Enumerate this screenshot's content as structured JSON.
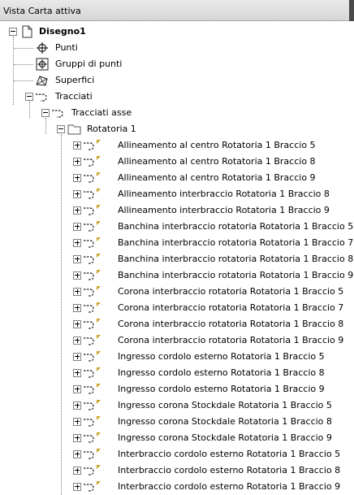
{
  "window": {
    "title": "Vista Carta attiva"
  },
  "tree": {
    "root": {
      "label": "Disegno1"
    },
    "level1": [
      {
        "label": "Punti",
        "icon": "point-icon"
      },
      {
        "label": "Gruppi di punti",
        "icon": "point-group-icon"
      },
      {
        "label": "Superfici",
        "icon": "surface-icon"
      },
      {
        "label": "Tracciati",
        "icon": "alignment-icon"
      }
    ],
    "alignment_group": {
      "label": "Tracciati asse",
      "icon": "alignment-icon"
    },
    "folder": {
      "label": "Rotatoria 1",
      "icon": "folder-icon"
    },
    "alignments": [
      {
        "label": "Allineamento al centro Rotatoria 1 Braccio 5"
      },
      {
        "label": "Allineamento al centro Rotatoria 1 Braccio 8"
      },
      {
        "label": "Allineamento al centro Rotatoria 1 Braccio 9"
      },
      {
        "label": "Allineamento interbraccio Rotatoria 1 Braccio 8"
      },
      {
        "label": "Allineamento interbraccio Rotatoria 1 Braccio 9"
      },
      {
        "label": "Banchina interbraccio rotatoria Rotatoria 1 Braccio 5"
      },
      {
        "label": "Banchina interbraccio rotatoria Rotatoria 1 Braccio 7"
      },
      {
        "label": "Banchina interbraccio rotatoria Rotatoria 1 Braccio 8"
      },
      {
        "label": "Banchina interbraccio rotatoria Rotatoria 1 Braccio 9"
      },
      {
        "label": "Corona interbraccio rotatoria Rotatoria 1 Braccio 5"
      },
      {
        "label": "Corona interbraccio rotatoria Rotatoria 1 Braccio 7"
      },
      {
        "label": "Corona interbraccio rotatoria Rotatoria 1 Braccio 8"
      },
      {
        "label": "Corona interbraccio rotatoria Rotatoria 1 Braccio 9"
      },
      {
        "label": "Ingresso cordolo esterno Rotatoria 1 Braccio 5"
      },
      {
        "label": "Ingresso cordolo esterno Rotatoria 1 Braccio 8"
      },
      {
        "label": "Ingresso cordolo esterno Rotatoria 1 Braccio 9"
      },
      {
        "label": "Ingresso corona Stockdale Rotatoria 1 Braccio 5"
      },
      {
        "label": "Ingresso corona Stockdale Rotatoria 1 Braccio 8"
      },
      {
        "label": "Ingresso corona Stockdale Rotatoria 1 Braccio 9"
      },
      {
        "label": "Interbraccio cordolo esterno Rotatoria 1 Braccio 5"
      },
      {
        "label": "Interbraccio cordolo esterno Rotatoria 1 Braccio 8"
      },
      {
        "label": "Interbraccio cordolo esterno Rotatoria 1 Braccio 9"
      }
    ]
  },
  "colors": {
    "flag": "#c9a227",
    "folder_outline": "#555555",
    "icon": "#1f1f1f"
  }
}
